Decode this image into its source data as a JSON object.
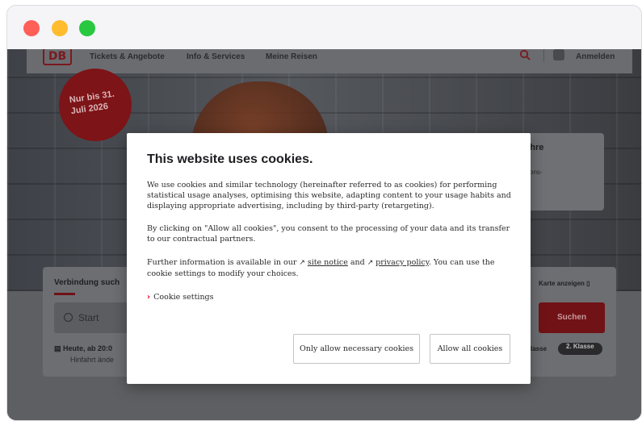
{
  "page": {
    "nav": {
      "logo": "DB",
      "links": [
        "Tickets & Angebote",
        "Info & Services",
        "Meine Reisen"
      ],
      "login": "Anmelden"
    },
    "hero": {
      "badge_line1": "Nur bis 31.",
      "badge_line2": "Juli 2026",
      "promo_title": "reis. Sie Ihre",
      "promo_text": "d 50 zum Aktions-"
    },
    "search": {
      "title": "Verbindung such",
      "map_link": "Karte anzeigen",
      "start_placeholder": "Start",
      "search_button": "Suchen",
      "date_line": "Heute, ab 20:0",
      "return_line": "Hinfahrt ände",
      "class_first": "lasse",
      "class_second": "2. Klasse"
    }
  },
  "cookie_modal": {
    "title": "This website uses cookies.",
    "para1": "We use cookies and similar technology (hereinafter referred to as cookies) for performing statistical usage analyses, optimising this website, adapting content to your usage habits and displaying appropriate advertising, including by third-party (retargeting).",
    "para2": "By clicking on \"Allow all cookies\", you consent to the processing of your data and its transfer to our contractual partners.",
    "para3_prefix": "Further information is available in our ",
    "site_notice": "site notice",
    "para3_and": " and ",
    "privacy_policy": "privacy policy",
    "para3_suffix": ". You can use the cookie settings to modify your choices.",
    "cookie_settings": "Cookie settings",
    "btn_necessary": "Only allow necessary cookies",
    "btn_all": "Allow all cookies"
  },
  "colors": {
    "accent": "#ec0016",
    "traffic_red": "#fe5f57",
    "traffic_yellow": "#febc2e",
    "traffic_green": "#28c840"
  }
}
